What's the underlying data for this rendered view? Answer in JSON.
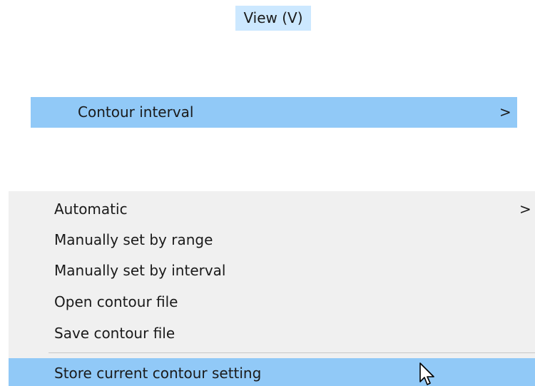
{
  "menubar": {
    "view_label": "View (V)"
  },
  "view_menu": {
    "contour_interval_label": "Contour interval",
    "contour_interval_chevron": ">"
  },
  "contour_submenu": {
    "items": [
      {
        "label": "Automatic",
        "chevron": ">"
      },
      {
        "label": "Manually set by range"
      },
      {
        "label": "Manually set by interval"
      },
      {
        "label": "Open contour file"
      },
      {
        "label": "Save contour file"
      },
      {
        "label": "Store current contour setting"
      }
    ]
  },
  "icons": {
    "cursor": "mouse-pointer-icon",
    "submenu_arrow": "chevron-right-icon"
  },
  "colors": {
    "highlight": "#91c9f7",
    "menubar_highlight": "#cce8ff",
    "menu_background": "#f0f0f0",
    "separator": "#c8c8c8"
  }
}
